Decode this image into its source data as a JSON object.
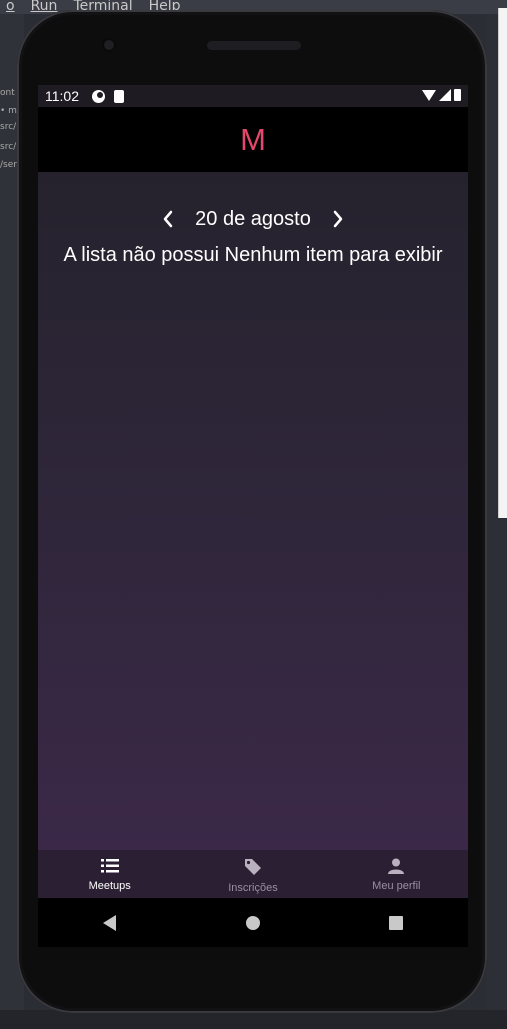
{
  "ide": {
    "menu": [
      "o",
      "Run",
      "Terminal",
      "Help"
    ],
    "left_fragments": [
      "ont",
      "• m",
      "src/",
      "src/",
      "/ser"
    ]
  },
  "status_bar": {
    "time": "11:02"
  },
  "app": {
    "logo_letter": "M",
    "accent_color": "#e3476a",
    "date_nav": {
      "date_label": "20 de agosto",
      "prev_icon": "chevron-left-icon",
      "next_icon": "chevron-right-icon"
    },
    "empty_message": "A lista não possui Nenhum item para exibir",
    "tabs": [
      {
        "label": "Meetups",
        "icon": "list-icon",
        "active": true
      },
      {
        "label": "Inscrições",
        "icon": "tag-icon",
        "active": false
      },
      {
        "label": "Meu perfil",
        "icon": "person-icon",
        "active": false
      }
    ]
  },
  "system_nav": [
    "back-icon",
    "home-icon",
    "recents-icon"
  ]
}
